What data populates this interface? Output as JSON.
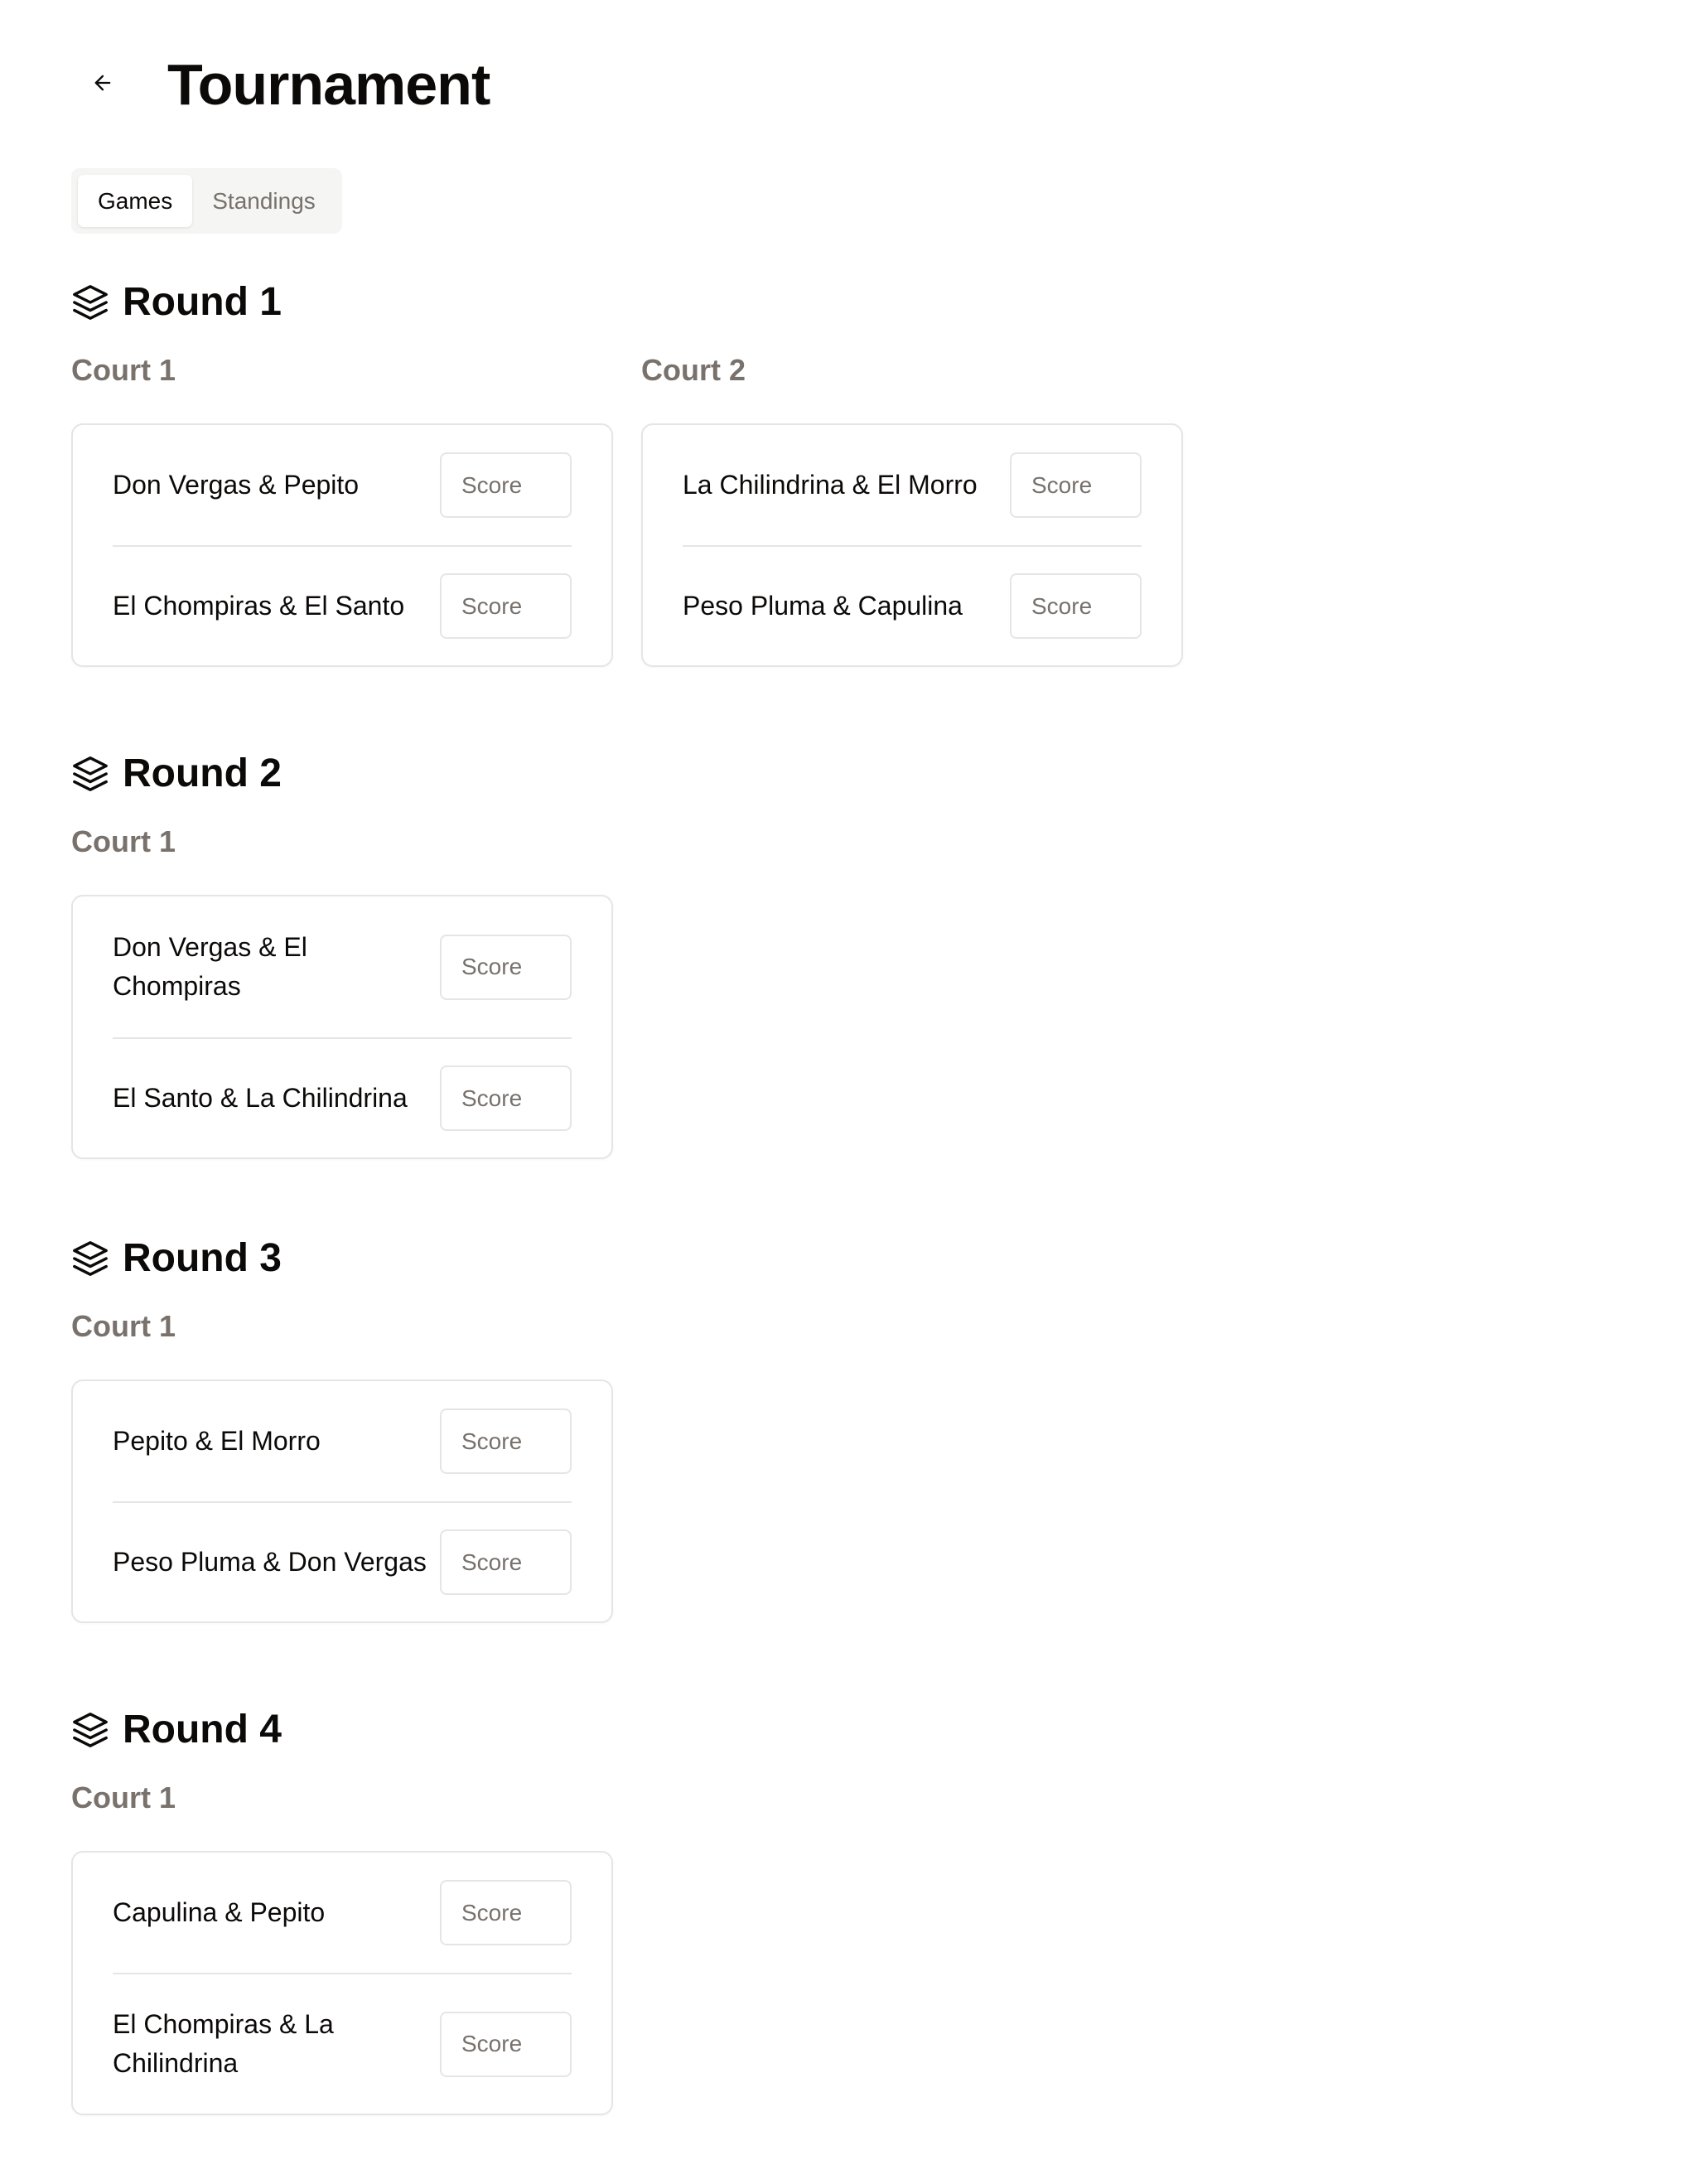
{
  "page": {
    "title": "Tournament",
    "back_icon": "arrow-left-icon"
  },
  "tabs": [
    {
      "label": "Games",
      "active": true
    },
    {
      "label": "Standings",
      "active": false
    }
  ],
  "score_placeholder": "Score",
  "rounds": [
    {
      "title": "Round 1",
      "icon": "layers-icon",
      "courts": [
        {
          "label": "Court 1",
          "teams": [
            "Don Vergas & Pepito",
            "El Chompiras & El Santo"
          ]
        },
        {
          "label": "Court 2",
          "teams": [
            "La Chilindrina & El Morro",
            "Peso Pluma & Capulina"
          ]
        }
      ]
    },
    {
      "title": "Round 2",
      "icon": "layers-icon",
      "courts": [
        {
          "label": "Court 1",
          "teams": [
            "Don Vergas & El Chompiras",
            "El Santo & La Chilindrina"
          ]
        }
      ]
    },
    {
      "title": "Round 3",
      "icon": "layers-icon",
      "courts": [
        {
          "label": "Court 1",
          "teams": [
            "Pepito & El Morro",
            "Peso Pluma & Don Vergas"
          ]
        }
      ]
    },
    {
      "title": "Round 4",
      "icon": "layers-icon",
      "courts": [
        {
          "label": "Court 1",
          "teams": [
            "Capulina & Pepito",
            "El Chompiras & La Chilindrina"
          ]
        }
      ]
    }
  ]
}
